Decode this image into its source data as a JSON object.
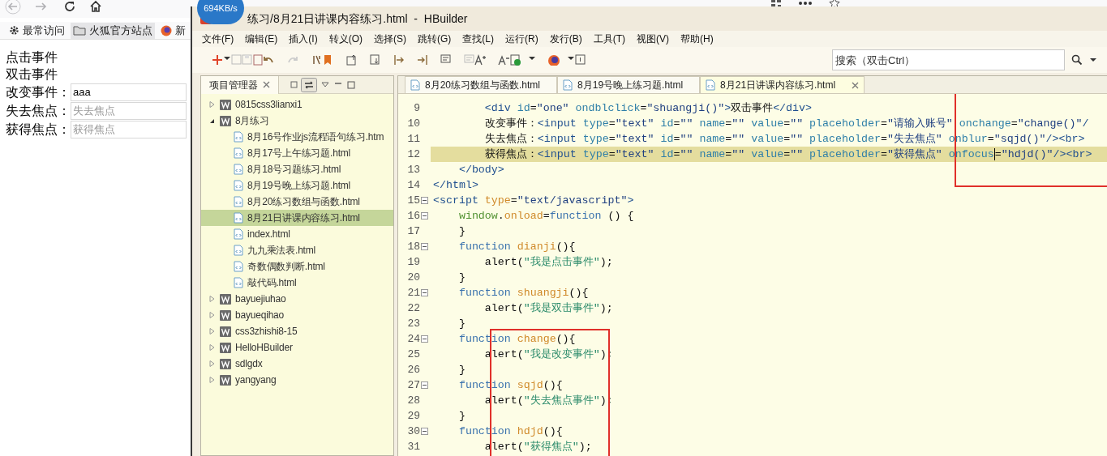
{
  "browser": {
    "speed_badge": "694KB/s",
    "bookmarks": [
      {
        "label": "最常访问",
        "kind": "gear",
        "selected": false
      },
      {
        "label": "火狐官方站点",
        "kind": "folder",
        "selected": true
      },
      {
        "label": "新",
        "kind": "firefox",
        "selected": false
      }
    ],
    "page": {
      "lines": [
        "点击事件",
        "双击事件"
      ],
      "fields": [
        {
          "label": "改变事件：",
          "value": "aaa"
        },
        {
          "label": "失去焦点：",
          "placeholder": "失去焦点"
        },
        {
          "label": "获得焦点：",
          "placeholder": "获得焦点"
        }
      ]
    }
  },
  "editor": {
    "title": "练习/8月21日讲课内容练习.html  -  HBuilder",
    "menu": [
      "文件(F)",
      "编辑(E)",
      "插入(I)",
      "转义(O)",
      "选择(S)",
      "跳转(G)",
      "查找(L)",
      "运行(R)",
      "发行(B)",
      "工具(T)",
      "视图(V)",
      "帮助(H)"
    ],
    "search": {
      "placeholder": "搜索（双击Ctrl）"
    },
    "project_panel": {
      "title": "项目管理器",
      "tree": [
        {
          "label": "0815css3lianxi1",
          "kind": "project",
          "expanded": false,
          "selected": false
        },
        {
          "label": "8月练习",
          "kind": "project",
          "expanded": true,
          "selected": false,
          "children": [
            {
              "label": "8月16号作业js流程语句练习.htm",
              "kind": "file",
              "selected": false
            },
            {
              "label": "8月17号上午练习题.html",
              "kind": "file",
              "selected": false
            },
            {
              "label": "8月18号习题练习.html",
              "kind": "file",
              "selected": false
            },
            {
              "label": "8月19号晚上练习题.html",
              "kind": "file",
              "selected": false
            },
            {
              "label": "8月20练习数组与函数.html",
              "kind": "file",
              "selected": false
            },
            {
              "label": "8月21日讲课内容练习.html",
              "kind": "file",
              "selected": true
            },
            {
              "label": "index.html",
              "kind": "file",
              "selected": false
            },
            {
              "label": "九九乘法表.html",
              "kind": "file",
              "selected": false
            },
            {
              "label": "奇数偶数判断.html",
              "kind": "file",
              "selected": false
            },
            {
              "label": "敲代码.html",
              "kind": "file",
              "selected": false
            }
          ]
        },
        {
          "label": "bayuejiuhao",
          "kind": "project",
          "expanded": false,
          "selected": false
        },
        {
          "label": "bayueqihao",
          "kind": "project",
          "expanded": false,
          "selected": false
        },
        {
          "label": "css3zhishi8-15",
          "kind": "project",
          "expanded": false,
          "selected": false
        },
        {
          "label": "HelloHBuilder",
          "kind": "project",
          "expanded": false,
          "selected": false
        },
        {
          "label": "sdlgdx",
          "kind": "project",
          "expanded": false,
          "selected": false
        },
        {
          "label": "yangyang",
          "kind": "project",
          "expanded": false,
          "selected": false
        }
      ]
    },
    "tabs": [
      {
        "label": "8月20练习数组与函数.html",
        "selected": false
      },
      {
        "label": "8月19号晚上练习题.html",
        "selected": false
      },
      {
        "label": "8月21日讲课内容练习.html",
        "selected": true
      }
    ],
    "code": [
      {
        "number": "9",
        "fold": false,
        "current": false,
        "tokens": [
          {
            "kind": "tag",
            "text": "        <div"
          },
          {
            "kind": "attr",
            "text": " id"
          },
          {
            "kind": "plain",
            "text": "="
          },
          {
            "kind": "value",
            "text": "\"one\""
          },
          {
            "kind": "attr",
            "text": " ondblclick"
          },
          {
            "kind": "plain",
            "text": "="
          },
          {
            "kind": "value",
            "text": "\"shuangji()\""
          },
          {
            "kind": "tag",
            "text": ">"
          },
          {
            "kind": "text",
            "text": "双击事件"
          },
          {
            "kind": "tag",
            "text": "</div>"
          }
        ]
      },
      {
        "number": "10",
        "fold": false,
        "current": false,
        "tokens": [
          {
            "kind": "text",
            "text": "        改变事件："
          },
          {
            "kind": "tag",
            "text": "<input"
          },
          {
            "kind": "attr",
            "text": " type"
          },
          {
            "kind": "plain",
            "text": "="
          },
          {
            "kind": "value",
            "text": "\"text\""
          },
          {
            "kind": "attr",
            "text": " id"
          },
          {
            "kind": "plain",
            "text": "="
          },
          {
            "kind": "value",
            "text": "\"\""
          },
          {
            "kind": "attr",
            "text": " name"
          },
          {
            "kind": "plain",
            "text": "="
          },
          {
            "kind": "value",
            "text": "\"\""
          },
          {
            "kind": "attr",
            "text": " value"
          },
          {
            "kind": "plain",
            "text": "="
          },
          {
            "kind": "value",
            "text": "\"\""
          },
          {
            "kind": "attr",
            "text": " placeholder"
          },
          {
            "kind": "plain",
            "text": "="
          },
          {
            "kind": "value",
            "text": "\"请输入账号\""
          },
          {
            "kind": "attr",
            "text": " onchange"
          },
          {
            "kind": "plain",
            "text": "="
          },
          {
            "kind": "value",
            "text": "\"change()\""
          },
          {
            "kind": "tag",
            "text": "/"
          }
        ]
      },
      {
        "number": "11",
        "fold": false,
        "current": false,
        "tokens": [
          {
            "kind": "text",
            "text": "        失去焦点："
          },
          {
            "kind": "tag",
            "text": "<input"
          },
          {
            "kind": "attr",
            "text": " type"
          },
          {
            "kind": "plain",
            "text": "="
          },
          {
            "kind": "value",
            "text": "\"text\""
          },
          {
            "kind": "attr",
            "text": " id"
          },
          {
            "kind": "plain",
            "text": "="
          },
          {
            "kind": "value",
            "text": "\"\""
          },
          {
            "kind": "attr",
            "text": " name"
          },
          {
            "kind": "plain",
            "text": "="
          },
          {
            "kind": "value",
            "text": "\"\""
          },
          {
            "kind": "attr",
            "text": " value"
          },
          {
            "kind": "plain",
            "text": "="
          },
          {
            "kind": "value",
            "text": "\"\""
          },
          {
            "kind": "attr",
            "text": " placeholder"
          },
          {
            "kind": "plain",
            "text": "="
          },
          {
            "kind": "value",
            "text": "\"失去焦点\""
          },
          {
            "kind": "attr",
            "text": " onblur"
          },
          {
            "kind": "plain",
            "text": "="
          },
          {
            "kind": "value",
            "text": "\"sqjd()\""
          },
          {
            "kind": "tag",
            "text": "/><br>"
          }
        ]
      },
      {
        "number": "12",
        "fold": false,
        "current": true,
        "tokens": [
          {
            "kind": "text",
            "text": "        获得焦点："
          },
          {
            "kind": "tag",
            "text": "<input"
          },
          {
            "kind": "attr",
            "text": " type"
          },
          {
            "kind": "plain",
            "text": "="
          },
          {
            "kind": "value",
            "text": "\"text\""
          },
          {
            "kind": "attr",
            "text": " id"
          },
          {
            "kind": "plain",
            "text": "="
          },
          {
            "kind": "value",
            "text": "\"\""
          },
          {
            "kind": "attr",
            "text": " name"
          },
          {
            "kind": "plain",
            "text": "="
          },
          {
            "kind": "value",
            "text": "\"\""
          },
          {
            "kind": "attr",
            "text": " value"
          },
          {
            "kind": "plain",
            "text": "="
          },
          {
            "kind": "value",
            "text": "\"\""
          },
          {
            "kind": "attr",
            "text": " placeholder"
          },
          {
            "kind": "plain",
            "text": "="
          },
          {
            "kind": "value",
            "text": "\"获得焦点\""
          },
          {
            "kind": "attr",
            "text": " onfocus",
            "caret": true
          },
          {
            "kind": "plain",
            "text": "="
          },
          {
            "kind": "value",
            "text": "\"hdjd()\""
          },
          {
            "kind": "tag",
            "text": "/><br>"
          }
        ]
      },
      {
        "number": "13",
        "fold": false,
        "current": false,
        "tokens": [
          {
            "kind": "tag",
            "text": "    </body>"
          }
        ]
      },
      {
        "number": "14",
        "fold": false,
        "current": false,
        "tokens": [
          {
            "kind": "tag",
            "text": "</html>"
          }
        ]
      },
      {
        "number": "15",
        "fold": true,
        "current": false,
        "tokens": [
          {
            "kind": "tag",
            "text": "<script"
          },
          {
            "kind": "name",
            "text": " type"
          },
          {
            "kind": "plain",
            "text": "="
          },
          {
            "kind": "value",
            "text": "\"text/javascript\""
          },
          {
            "kind": "tag",
            "text": ">"
          }
        ]
      },
      {
        "number": "16",
        "fold": true,
        "current": false,
        "tokens": [
          {
            "kind": "object",
            "text": "    window"
          },
          {
            "kind": "plain",
            "text": "."
          },
          {
            "kind": "name",
            "text": "onload"
          },
          {
            "kind": "plain",
            "text": "="
          },
          {
            "kind": "keyword",
            "text": "function"
          },
          {
            "kind": "plain",
            "text": " () {"
          }
        ]
      },
      {
        "number": "17",
        "fold": false,
        "current": false,
        "tokens": [
          {
            "kind": "plain",
            "text": "    }"
          }
        ]
      },
      {
        "number": "18",
        "fold": true,
        "current": false,
        "tokens": [
          {
            "kind": "keyword",
            "text": "    function"
          },
          {
            "kind": "name",
            "text": " dianji"
          },
          {
            "kind": "plain",
            "text": "(){"
          }
        ]
      },
      {
        "number": "19",
        "fold": false,
        "current": false,
        "tokens": [
          {
            "kind": "plain",
            "text": "        alert("
          },
          {
            "kind": "string",
            "text": "\"我是点击事件\""
          },
          {
            "kind": "plain",
            "text": ");"
          }
        ]
      },
      {
        "number": "20",
        "fold": false,
        "current": false,
        "tokens": [
          {
            "kind": "plain",
            "text": "    }"
          }
        ]
      },
      {
        "number": "21",
        "fold": true,
        "current": false,
        "tokens": [
          {
            "kind": "keyword",
            "text": "    function"
          },
          {
            "kind": "name",
            "text": " shuangji"
          },
          {
            "kind": "plain",
            "text": "(){"
          }
        ]
      },
      {
        "number": "22",
        "fold": false,
        "current": false,
        "tokens": [
          {
            "kind": "plain",
            "text": "        alert("
          },
          {
            "kind": "string",
            "text": "\"我是双击事件\""
          },
          {
            "kind": "plain",
            "text": ");"
          }
        ]
      },
      {
        "number": "23",
        "fold": false,
        "current": false,
        "tokens": [
          {
            "kind": "plain",
            "text": "    }"
          }
        ]
      },
      {
        "number": "24",
        "fold": true,
        "current": false,
        "tokens": [
          {
            "kind": "keyword",
            "text": "    function"
          },
          {
            "kind": "name",
            "text": " change"
          },
          {
            "kind": "plain",
            "text": "(){"
          }
        ]
      },
      {
        "number": "25",
        "fold": false,
        "current": false,
        "tokens": [
          {
            "kind": "plain",
            "text": "        alert("
          },
          {
            "kind": "string",
            "text": "\"我是改变事件\""
          },
          {
            "kind": "plain",
            "text": ");"
          }
        ]
      },
      {
        "number": "26",
        "fold": false,
        "current": false,
        "tokens": [
          {
            "kind": "plain",
            "text": "    }"
          }
        ]
      },
      {
        "number": "27",
        "fold": true,
        "current": false,
        "tokens": [
          {
            "kind": "keyword",
            "text": "    function"
          },
          {
            "kind": "name",
            "text": " sqjd"
          },
          {
            "kind": "plain",
            "text": "(){"
          }
        ]
      },
      {
        "number": "28",
        "fold": false,
        "current": false,
        "tokens": [
          {
            "kind": "plain",
            "text": "        alert("
          },
          {
            "kind": "string",
            "text": "\"失去焦点事件\""
          },
          {
            "kind": "plain",
            "text": ");"
          }
        ]
      },
      {
        "number": "29",
        "fold": false,
        "current": false,
        "tokens": [
          {
            "kind": "plain",
            "text": "    }"
          }
        ]
      },
      {
        "number": "30",
        "fold": true,
        "current": false,
        "tokens": [
          {
            "kind": "keyword",
            "text": "    function"
          },
          {
            "kind": "name",
            "text": " hdjd"
          },
          {
            "kind": "plain",
            "text": "(){"
          }
        ]
      },
      {
        "number": "31",
        "fold": false,
        "current": false,
        "tokens": [
          {
            "kind": "plain",
            "text": "        alert("
          },
          {
            "kind": "string",
            "text": "\"获得焦点\""
          },
          {
            "kind": "plain",
            "text": ");"
          }
        ]
      }
    ]
  }
}
